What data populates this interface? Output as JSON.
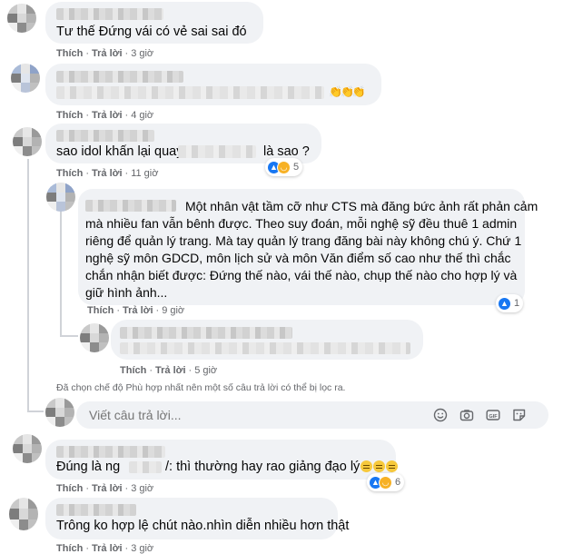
{
  "actions": {
    "like": "Thích",
    "reply": "Trả lời",
    "sep": "·"
  },
  "comments": [
    {
      "text": "Tư thế Đứng vái có vẻ sai sai đó",
      "time": "3 giờ"
    },
    {
      "text": "👏👏👏",
      "time": "4 giờ"
    },
    {
      "text_before": "sao idol khấn lại quay",
      "text_after": "là sao ?",
      "time": "11 giờ",
      "reaction_count": "5"
    },
    {
      "text_lines": [
        "Một nhân vật tầm cỡ như CTS mà đăng bức ảnh rất phản cảm",
        "mà nhiều fan vẫn bênh được. Theo suy đoán, mỗi nghệ sỹ đều thuê 1 admin",
        "riêng để quản lý trang. Mà tay quản lý trang đăng bài này không chú ý. Chứ 1",
        "nghệ sỹ môn GDCD, môn lịch sử và môn Văn điểm số cao như thế thì chắc",
        "chắn nhận biết được: Đứng thế nào, vái thế nào, chụp thế nào cho hợp lý và",
        "giữ hình ảnh..."
      ],
      "time": "9 giờ",
      "reaction_count": "1"
    },
    {
      "time": "5 giờ"
    },
    {
      "text_before": "Đúng là ng",
      "text_after": "/: thì thường hay rao giảng đạo lý",
      "time": "3 giờ",
      "reaction_count": "6"
    },
    {
      "text": "Trông ko hợp lệ chút nào.nhìn diễn nhiều hơn thật",
      "time": "3 giờ"
    }
  ],
  "filter_notice": "Đã chọn chế độ Phù hợp nhất nên một số câu trả lời có thể bị lọc ra.",
  "reply_box": {
    "placeholder": "Viết câu trả lời..."
  },
  "icons": [
    "emoji-icon",
    "camera-icon",
    "gif-icon",
    "sticker-icon",
    "like-reaction-icon",
    "haha-reaction-icon"
  ],
  "colors": {
    "bubble": "#f0f2f5",
    "meta_text": "#65676b",
    "like_blue": "#1877f2",
    "haha_yellow": "#f7b125"
  }
}
